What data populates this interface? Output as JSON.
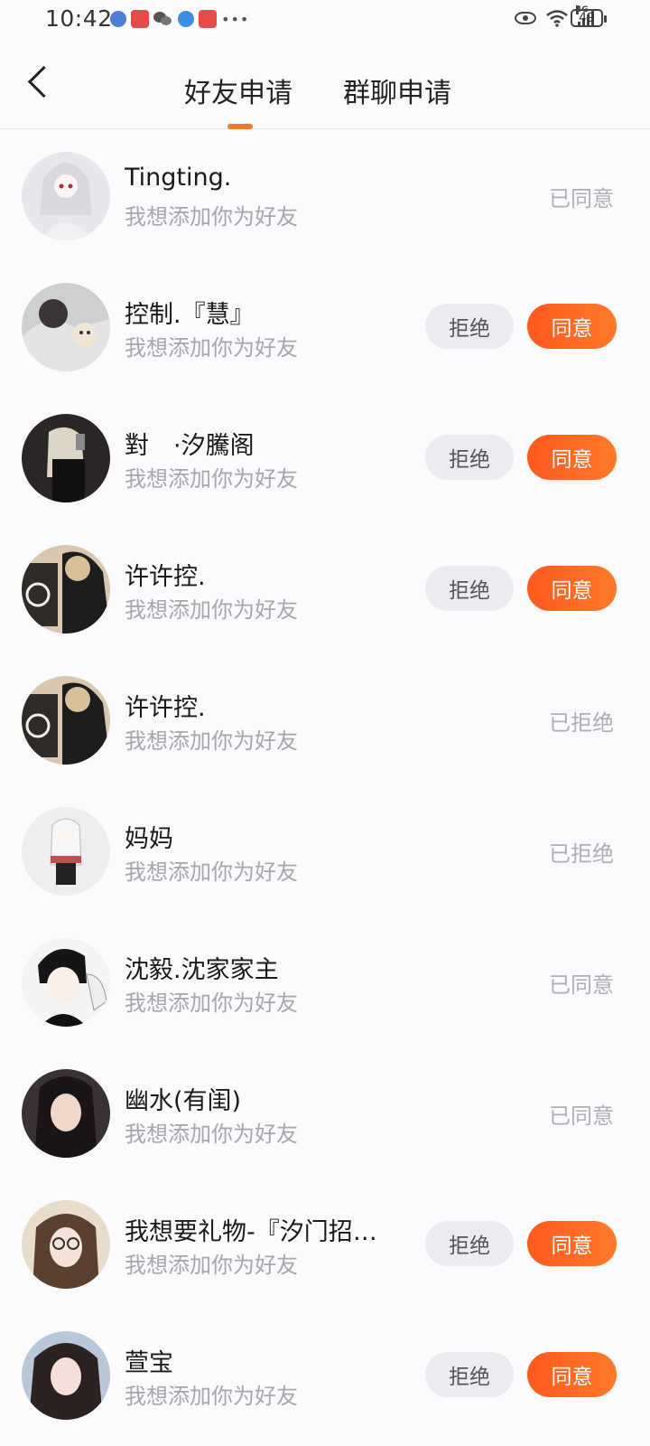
{
  "status_bar": {
    "time": "10:42",
    "battery": "49",
    "network": "4G"
  },
  "nav": {
    "tabs": [
      {
        "label": "好友申请",
        "active": true
      },
      {
        "label": "群聊申请",
        "active": false
      }
    ],
    "accent_color": "#f07b2a"
  },
  "buttons": {
    "reject": "拒绝",
    "accept": "同意"
  },
  "requests": [
    {
      "name": "Tingting.",
      "message": "我想添加你为好友",
      "state": "accepted",
      "status_text": "已同意"
    },
    {
      "name": "控制.『慧』",
      "message": "我想添加你为好友",
      "state": "pending",
      "status_text": ""
    },
    {
      "name": "對　·汐騰阁",
      "message": "我想添加你为好友",
      "state": "pending",
      "status_text": ""
    },
    {
      "name": "许许控.",
      "message": "我想添加你为好友",
      "state": "pending",
      "status_text": ""
    },
    {
      "name": "许许控.",
      "message": "我想添加你为好友",
      "state": "rejected",
      "status_text": "已拒绝"
    },
    {
      "name": "妈妈",
      "message": "我想添加你为好友",
      "state": "rejected",
      "status_text": "已拒绝"
    },
    {
      "name": "沈毅.沈家家主",
      "message": "我想添加你为好友",
      "state": "accepted",
      "status_text": "已同意"
    },
    {
      "name": "幽水(有闺)",
      "message": "我想添加你为好友",
      "state": "accepted",
      "status_text": "已同意"
    },
    {
      "name": "我想要礼物-『汐门招…",
      "message": "我想添加你为好友",
      "state": "pending",
      "status_text": ""
    },
    {
      "name": "萱宝",
      "message": "我想添加你为好友",
      "state": "pending",
      "status_text": ""
    }
  ],
  "colors": {
    "accept_button": "#ff6a22",
    "reject_button": "#ebebf1",
    "subtitle": "#a6a6ae"
  }
}
